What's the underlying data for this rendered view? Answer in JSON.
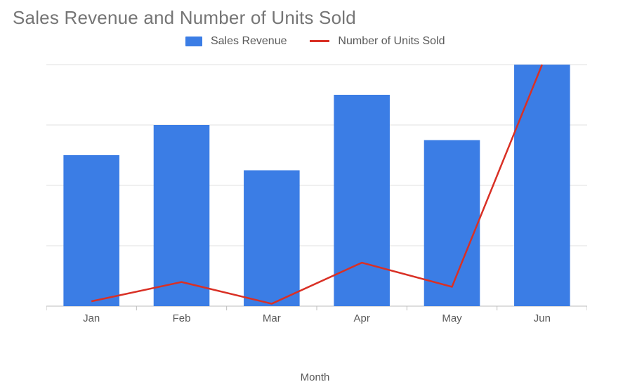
{
  "chart_data": {
    "type": "bar+line",
    "title": "Sales Revenue and Number of Units Sold",
    "xlabel": "Month",
    "categories": [
      "Jan",
      "Feb",
      "Mar",
      "Apr",
      "May",
      "Jun"
    ],
    "left_axis": {
      "label": "",
      "ticks": [
        0,
        2000,
        4000,
        6000,
        8000
      ],
      "min": 0,
      "max": 8000
    },
    "right_axis": {
      "label": "",
      "ticks": [
        0,
        1000,
        2000,
        3000,
        4000,
        5000
      ],
      "min": 0,
      "max": 5000
    },
    "series": [
      {
        "name": "Sales Revenue",
        "type": "bar",
        "axis": "left",
        "color": "#3b7de5",
        "values": [
          5000,
          6000,
          4500,
          7000,
          5500,
          8000
        ]
      },
      {
        "name": "Number of Units Sold",
        "type": "line",
        "axis": "right",
        "color": "#d93025",
        "values": [
          100,
          500,
          50,
          900,
          400,
          5000
        ]
      }
    ],
    "legend": {
      "position": "top"
    }
  }
}
